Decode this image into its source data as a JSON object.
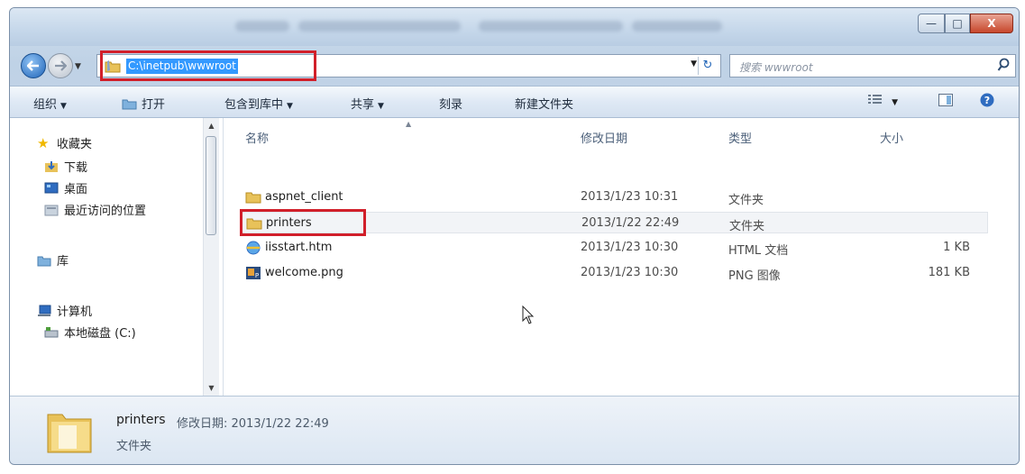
{
  "window": {
    "close_glyph": "X",
    "maximize_glyph": "□",
    "minimize_glyph": "—"
  },
  "address_bar": {
    "path": "C:\\inetpub\\wwwroot",
    "refresh_glyph": "↻",
    "dropdown_glyph": "▼"
  },
  "search": {
    "placeholder": "搜索 wwwroot",
    "icon": "search-icon"
  },
  "toolbar": {
    "organize": "组织",
    "open": "打开",
    "include_in_library": "包含到库中",
    "share": "共享",
    "burn": "刻录",
    "new_folder": "新建文件夹"
  },
  "nav_pane": {
    "favorites": "收藏夹",
    "downloads": "下载",
    "desktop": "桌面",
    "recent_places": "最近访问的位置",
    "libraries": "库",
    "computer": "计算机",
    "local_disk": "本地磁盘 (C:)"
  },
  "columns": {
    "name": "名称",
    "date_modified": "修改日期",
    "type": "类型",
    "size": "大小"
  },
  "files": [
    {
      "name": "aspnet_client",
      "date": "2013/1/23 10:31",
      "type": "文件夹",
      "size": "",
      "icon": "folder-icon"
    },
    {
      "name": "printers",
      "date": "2013/1/22 22:49",
      "type": "文件夹",
      "size": "",
      "icon": "folder-icon"
    },
    {
      "name": "iisstart.htm",
      "date": "2013/1/23 10:30",
      "type": "HTML 文档",
      "size": "1 KB",
      "icon": "html-file-icon"
    },
    {
      "name": "welcome.png",
      "date": "2013/1/23 10:30",
      "type": "PNG 图像",
      "size": "181 KB",
      "icon": "png-file-icon"
    }
  ],
  "details_pane": {
    "name": "printers",
    "meta": "修改日期: 2013/1/22 22:49",
    "type": "文件夹"
  },
  "colors": {
    "highlight_box": "#d11f2a",
    "address_selection": "#3399ff",
    "folder": "#e8c25a"
  }
}
